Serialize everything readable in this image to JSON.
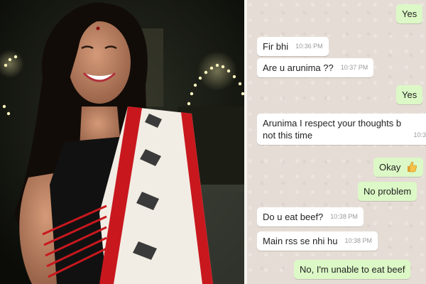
{
  "photo": {
    "description_icon": "portrait-photo"
  },
  "chat": {
    "messages": [
      {
        "dir": "out",
        "text": "Yes",
        "time": ""
      },
      {
        "dir": "in",
        "text": "Fir bhi",
        "time": "10:36 PM"
      },
      {
        "dir": "in",
        "text": "Are u arunima ??",
        "time": "10:37 PM"
      },
      {
        "dir": "out",
        "text": "Yes",
        "time": ""
      },
      {
        "dir": "in",
        "text": "Arunima I respect your thoughts b",
        "text2": "not this time",
        "time": "10:3"
      },
      {
        "dir": "out",
        "text": "Okay",
        "time": "",
        "icon": "thumbs-up-icon"
      },
      {
        "dir": "out",
        "text": "No problem",
        "time": ""
      },
      {
        "dir": "in",
        "text": "Do u eat beef?",
        "time": "10:38 PM"
      },
      {
        "dir": "in",
        "text": "Main rss se nhi hu",
        "time": "10:38 PM"
      },
      {
        "dir": "out",
        "text": "No, I'm unable to eat beef",
        "time": ""
      }
    ]
  },
  "colors": {
    "incoming_bubble": "#ffffff",
    "outgoing_bubble": "#dcf8c6",
    "chat_background": "#e5ddd5",
    "saree_red": "#c8181e"
  }
}
